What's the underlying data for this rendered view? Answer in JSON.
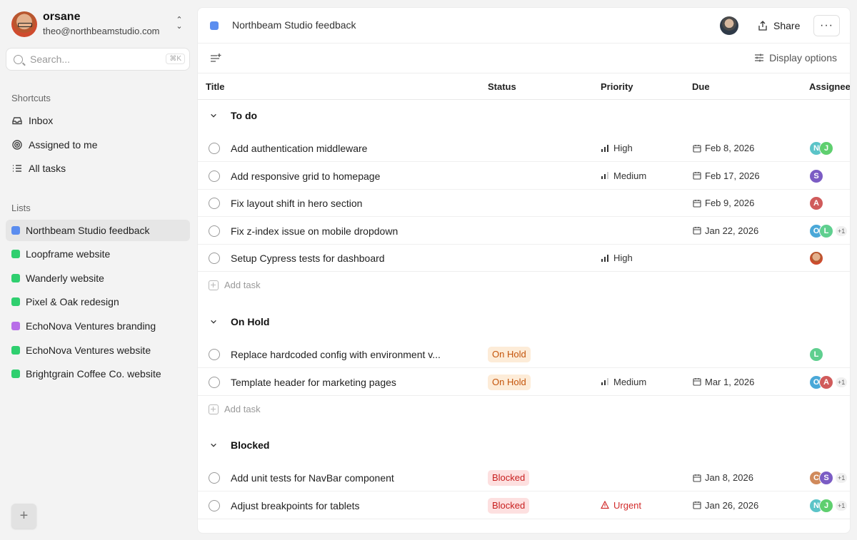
{
  "account": {
    "name": "orsane",
    "email": "theo@northbeamstudio.com"
  },
  "search": {
    "placeholder": "Search...",
    "shortcut": "⌘K"
  },
  "shortcuts": {
    "label": "Shortcuts",
    "items": [
      {
        "label": "Inbox",
        "icon": "inbox-icon"
      },
      {
        "label": "Assigned to me",
        "icon": "target-icon"
      },
      {
        "label": "All tasks",
        "icon": "list-icon"
      }
    ]
  },
  "lists": {
    "label": "Lists",
    "items": [
      {
        "label": "Northbeam Studio feedback",
        "color": "#5b8def",
        "active": true
      },
      {
        "label": "Loopframe website",
        "color": "#2fcf6f"
      },
      {
        "label": "Wanderly website",
        "color": "#2fcf6f"
      },
      {
        "label": "Pixel & Oak redesign",
        "color": "#2fcf6f"
      },
      {
        "label": "EchoNova Ventures branding",
        "color": "#b86ee8"
      },
      {
        "label": "EchoNova Ventures website",
        "color": "#2fcf6f"
      },
      {
        "label": "Brightgrain Coffee Co. website",
        "color": "#2fcf6f"
      }
    ]
  },
  "header": {
    "title": "Northbeam Studio feedback",
    "share_label": "Share",
    "more_label": "···"
  },
  "toolbar": {
    "display_options_label": "Display options"
  },
  "columns": {
    "title": "Title",
    "status": "Status",
    "priority": "Priority",
    "due": "Due",
    "assignee": "Assignee"
  },
  "add_task_label": "Add task",
  "groups": [
    {
      "title": "To do",
      "tasks": [
        {
          "title": "Add authentication middleware",
          "status": "",
          "priority": "High",
          "due": "Feb 8, 2026",
          "assignees": [
            {
              "l": "N",
              "c": "#5bc4c8"
            },
            {
              "l": "J",
              "c": "#5fcf6f"
            }
          ],
          "more": ""
        },
        {
          "title": "Add responsive grid to homepage",
          "status": "",
          "priority": "Medium",
          "due": "Feb 17, 2026",
          "assignees": [
            {
              "l": "S",
              "c": "#7b5cc4"
            }
          ],
          "more": ""
        },
        {
          "title": "Fix layout shift in hero section",
          "status": "",
          "priority": "",
          "due": "Feb 9, 2026",
          "assignees": [
            {
              "l": "A",
              "c": "#d05b5b"
            }
          ],
          "more": ""
        },
        {
          "title": "Fix z-index issue on mobile dropdown",
          "status": "",
          "priority": "",
          "due": "Jan 22, 2026",
          "assignees": [
            {
              "l": "O",
              "c": "#4aa8d8"
            },
            {
              "l": "L",
              "c": "#5fcf8f"
            }
          ],
          "more": "+1"
        },
        {
          "title": "Setup Cypress tests for dashboard",
          "status": "",
          "priority": "High",
          "due": "",
          "assignees": [
            {
              "l": "",
              "c": "#b8572f"
            }
          ],
          "more": ""
        }
      ]
    },
    {
      "title": "On Hold",
      "tasks": [
        {
          "title": "Replace hardcoded config with environment v...",
          "status": "On Hold",
          "priority": "",
          "due": "",
          "assignees": [
            {
              "l": "L",
              "c": "#5fcf8f"
            }
          ],
          "more": ""
        },
        {
          "title": "Template header for marketing pages",
          "status": "On Hold",
          "priority": "Medium",
          "due": "Mar 1, 2026",
          "assignees": [
            {
              "l": "O",
              "c": "#4aa8d8"
            },
            {
              "l": "A",
              "c": "#d05b5b"
            }
          ],
          "more": "+1"
        }
      ]
    },
    {
      "title": "Blocked",
      "tasks": [
        {
          "title": "Add unit tests for NavBar component",
          "status": "Blocked",
          "priority": "",
          "due": "Jan 8, 2026",
          "assignees": [
            {
              "l": "C",
              "c": "#d08a5b"
            },
            {
              "l": "S",
              "c": "#7b5cc4"
            }
          ],
          "more": "+1"
        },
        {
          "title": "Adjust breakpoints for tablets",
          "status": "Blocked",
          "priority": "Urgent",
          "due": "Jan 26, 2026",
          "assignees": [
            {
              "l": "N",
              "c": "#5bc4c8"
            },
            {
              "l": "J",
              "c": "#5fcf6f"
            }
          ],
          "more": "+1"
        }
      ]
    }
  ]
}
